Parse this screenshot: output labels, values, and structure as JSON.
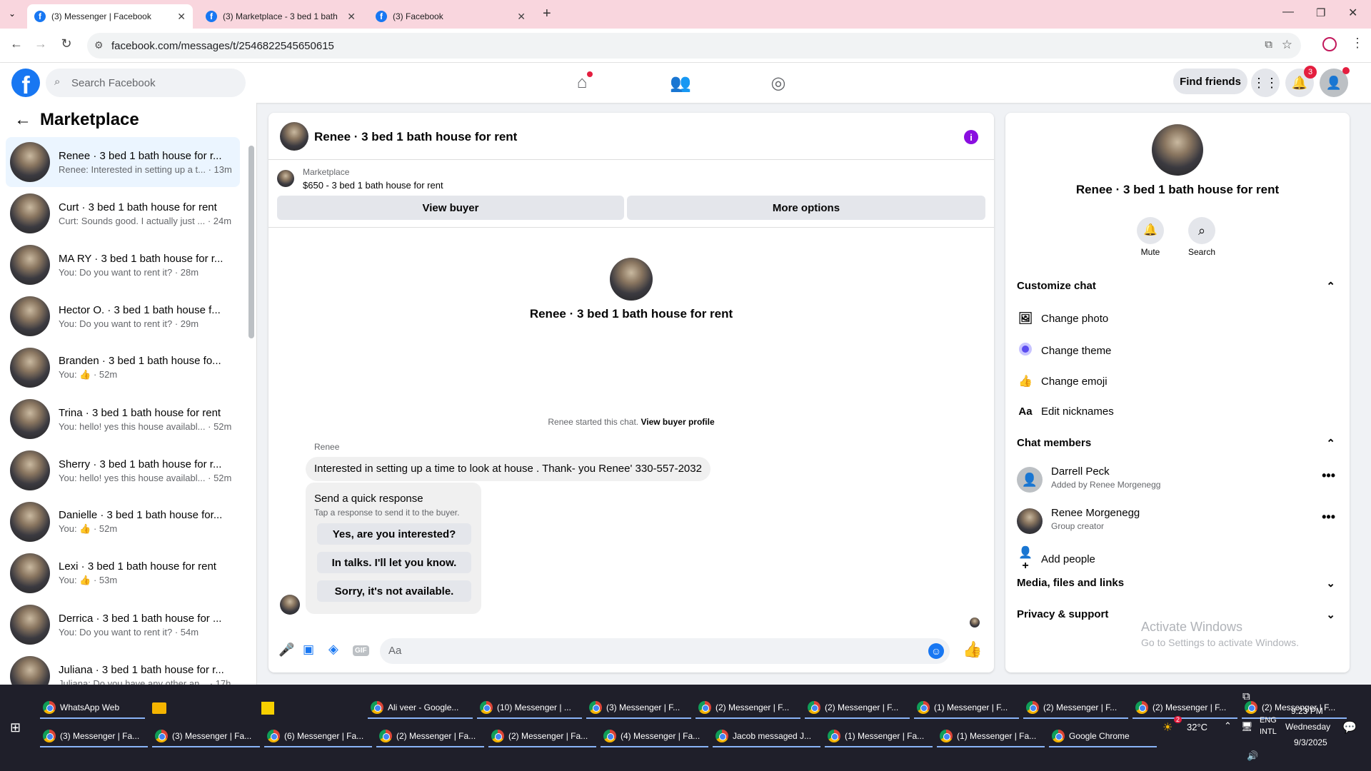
{
  "browser": {
    "tabs": [
      {
        "title": "(3) Messenger | Facebook",
        "active": true
      },
      {
        "title": "(3) Marketplace - 3 bed 1 bath",
        "active": false
      },
      {
        "title": "(3) Facebook",
        "active": false
      }
    ],
    "url": "facebook.com/messages/t/2546822545650615"
  },
  "fb": {
    "search_placeholder": "Search Facebook",
    "find_friends": "Find friends",
    "notif_count": "3"
  },
  "left": {
    "title": "Marketplace",
    "conversations": [
      {
        "name": "Renee · 3 bed 1 bath house for r...",
        "preview": "Renee: Interested in setting up a t...",
        "time": "13m",
        "selected": true
      },
      {
        "name": "Curt · 3 bed 1 bath house for rent",
        "preview": "Curt: Sounds good. I actually just ...",
        "time": "24m"
      },
      {
        "name": "MA RY · 3 bed 1 bath house for r...",
        "preview": "You: Do you want to rent it?",
        "time": "28m"
      },
      {
        "name": "Hector O. · 3 bed 1 bath house f...",
        "preview": "You: Do you want to rent it?",
        "time": "29m"
      },
      {
        "name": "Branden · 3 bed 1 bath house fo...",
        "preview": "You: 👍",
        "time": "52m"
      },
      {
        "name": "Trina · 3 bed 1 bath house for rent",
        "preview": "You: hello! yes this house availabl...",
        "time": "52m"
      },
      {
        "name": "Sherry · 3 bed 1 bath house for r...",
        "preview": "You: hello! yes this house availabl...",
        "time": "52m"
      },
      {
        "name": "Danielle · 3 bed 1 bath house for...",
        "preview": "You: 👍",
        "time": "52m"
      },
      {
        "name": "Lexi · 3 bed 1 bath house for rent",
        "preview": "You: 👍",
        "time": "53m"
      },
      {
        "name": "Derrica · 3 bed 1 bath house for ...",
        "preview": "You: Do you want to rent it?",
        "time": "54m"
      },
      {
        "name": "Juliana · 3 bed 1 bath house for r...",
        "preview": "Juliana: Do you have any other an...",
        "time": "17h"
      }
    ]
  },
  "chat": {
    "title": "Renee · 3 bed 1 bath house for rent",
    "listing_label": "Marketplace",
    "listing": "$650 - 3 bed 1 bath house for rent",
    "view_buyer": "View buyer",
    "more_options": "More options",
    "intro_name": "Renee · 3 bed 1 bath house for rent",
    "started_text": "Renee started this chat.",
    "view_buyer_profile": "View buyer profile",
    "sender": "Renee",
    "message": "Interested in setting up a time to look at house . Thank- you Renee' 330-557-2032",
    "quick_title": "Send a quick response",
    "quick_sub": "Tap a response to send it to the buyer.",
    "quick_responses": [
      "Yes, are you interested?",
      "In talks. I'll let you know.",
      "Sorry, it's not available."
    ],
    "input_placeholder": "Aa"
  },
  "right": {
    "name": "Renee · 3 bed 1 bath house for rent",
    "mute": "Mute",
    "search": "Search",
    "customize_chat": "Customize chat",
    "change_photo": "Change photo",
    "change_theme": "Change theme",
    "change_emoji": "Change emoji",
    "edit_nicknames": "Edit nicknames",
    "chat_members": "Chat members",
    "members": [
      {
        "name": "Darrell Peck",
        "sub": "Added by Renee Morgenegg"
      },
      {
        "name": "Renee Morgenegg",
        "sub": "Group creator"
      }
    ],
    "add_people": "Add people",
    "media": "Media, files and links",
    "privacy": "Privacy & support",
    "watermark_title": "Activate Windows",
    "watermark_sub": "Go to Settings to activate Windows."
  },
  "taskbar": {
    "row1": [
      "WhatsApp Web",
      "",
      "",
      "Ali veer - Google...",
      "(10) Messenger | ...",
      "(3) Messenger | F...",
      "(2) Messenger | F...",
      "(2) Messenger | F...",
      "(1) Messenger | F...",
      "(2) Messenger | F...",
      "(2) Messenger | F...",
      "(2) Messenger | F..."
    ],
    "row2": [
      "(3) Messenger | Fa...",
      "(3) Messenger | Fa...",
      "(6) Messenger | Fa...",
      "(2) Messenger | Fa...",
      "(2) Messenger | Fa...",
      "(4) Messenger | Fa...",
      "Jacob messaged J...",
      "(1) Messenger | Fa...",
      "(1) Messenger | Fa...",
      "Google Chrome"
    ],
    "weather": "32°C",
    "weather_badge": "2",
    "lang1": "ENG",
    "lang2": "INTL",
    "time": "9:23 PM",
    "day": "Wednesday",
    "date": "9/3/2025"
  },
  "colors": {
    "fb_blue": "#1877f2",
    "selected_bg": "#ebf5ff",
    "tab_bar": "#f9d6de",
    "taskbar": "#1f1f2a"
  }
}
